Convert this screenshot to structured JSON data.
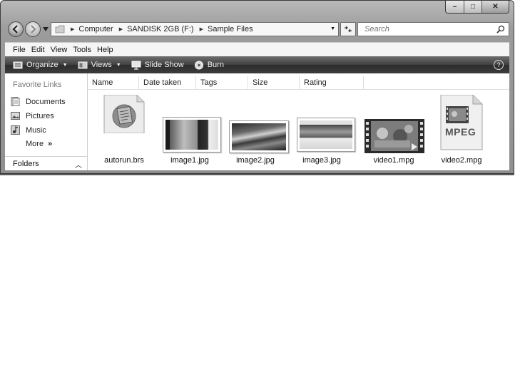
{
  "window": {
    "caption_buttons": {
      "minimize": "–",
      "maximize": "□",
      "close": "✕"
    }
  },
  "address": {
    "breadcrumbs": [
      "Computer",
      "SANDISK 2GB (F:)",
      "Sample Files"
    ],
    "search_placeholder": "Search"
  },
  "menu": [
    "File",
    "Edit",
    "View",
    "Tools",
    "Help"
  ],
  "toolbar": {
    "organize": "Organize",
    "views": "Views",
    "slideshow": "Slide Show",
    "burn": "Burn",
    "help_glyph": "?"
  },
  "nav_pane": {
    "title": "Favorite Links",
    "links": [
      {
        "label": "Documents",
        "icon": "documents-icon"
      },
      {
        "label": "Pictures",
        "icon": "pictures-icon"
      },
      {
        "label": "Music",
        "icon": "music-icon"
      }
    ],
    "more": "More",
    "more_glyph": "»",
    "folders": "Folders"
  },
  "columns": [
    "Name",
    "Date taken",
    "Tags",
    "Size",
    "Rating"
  ],
  "files": [
    {
      "name": "autorun.brs",
      "icon": "script-file-icon"
    },
    {
      "name": "image1.jpg",
      "icon": "image-thumbnail"
    },
    {
      "name": "image2.jpg",
      "icon": "image-thumbnail"
    },
    {
      "name": "image3.jpg",
      "icon": "image-thumbnail"
    },
    {
      "name": "video1.mpg",
      "icon": "video-thumbnail"
    },
    {
      "name": "video2.mpg",
      "icon": "mpeg-file-icon",
      "badge": "MPEG"
    }
  ]
}
